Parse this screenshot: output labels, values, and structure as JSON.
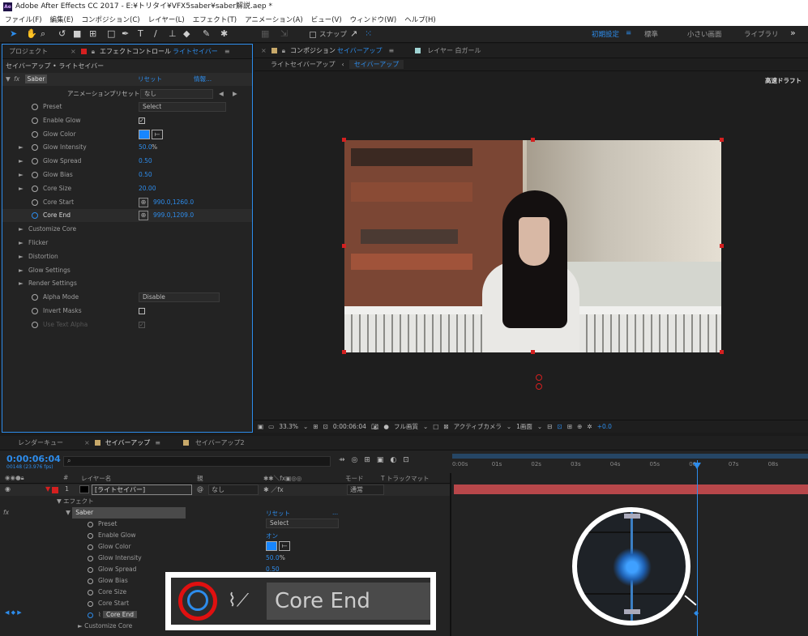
{
  "window": {
    "title": "Adobe After Effects CC 2017 - E:¥トリタイ¥VFX5saber¥saber解説.aep *"
  },
  "menu": [
    "ファイル(F)",
    "編集(E)",
    "コンポジション(C)",
    "レイヤー(L)",
    "エフェクト(T)",
    "アニメーション(A)",
    "ビュー(V)",
    "ウィンドウ(W)",
    "ヘルプ(H)"
  ],
  "toolbar": {
    "snap": "スナップ",
    "workspaces": [
      "初期設定",
      "標準",
      "小さい画面",
      "ライブラリ"
    ],
    "more": "»"
  },
  "left_panel": {
    "tab_project": "プロジェクト",
    "tab_effect_prefix": "エフェクトコントロール",
    "tab_effect_layer": "ライトセイバー",
    "breadcrumb": "セイバーアップ • ライトセイバー",
    "fx": "fx",
    "effect_name": "Saber",
    "reset": "リセット",
    "about": "情報...",
    "preset_label": "アニメーションプリセット：",
    "preset_value": "なし",
    "props": [
      {
        "name": "Preset",
        "kind": "dropdown",
        "value": "Select"
      },
      {
        "name": "Enable Glow",
        "kind": "check",
        "value": "✓"
      },
      {
        "name": "Glow Color",
        "kind": "color",
        "value": "#1786ff"
      },
      {
        "name": "Glow Intensity",
        "kind": "num",
        "value": "50.0",
        "suffix": "%",
        "twirl": "►"
      },
      {
        "name": "Glow Spread",
        "kind": "num",
        "value": "0.50",
        "twirl": "►"
      },
      {
        "name": "Glow Bias",
        "kind": "num",
        "value": "0.50",
        "twirl": "►"
      },
      {
        "name": "Core Size",
        "kind": "num",
        "value": "20.00",
        "twirl": "►"
      },
      {
        "name": "Core Start",
        "kind": "point",
        "value": "990.0,1260.0"
      },
      {
        "name": "Core End",
        "kind": "point",
        "value": "999.0,1209.0"
      }
    ],
    "groups": [
      "Customize Core",
      "Flicker",
      "Distortion",
      "Glow Settings",
      "Render Settings"
    ],
    "props2": [
      {
        "name": "Alpha Mode",
        "kind": "dropdown",
        "value": "Disable"
      },
      {
        "name": "Invert Masks",
        "kind": "check",
        "value": ""
      },
      {
        "name": "Use Text Alpha",
        "kind": "check",
        "value": "✓"
      }
    ]
  },
  "comp_panel": {
    "tab_prefix": "コンポジション",
    "tab_name": "セイバーアップ",
    "tab_layer": "レイヤー 白ガール",
    "sub1": "ライトセイバーアップ",
    "sub2": "セイバーアップ",
    "draft": "高速ドラフト",
    "zoom": "33.3%",
    "timecode": "0:00:06:04",
    "resolution": "フル画質",
    "camera": "アクティブカメラ",
    "views": "1画面",
    "exposure": "+0.0"
  },
  "timeline": {
    "tab_render": "レンダーキュー",
    "tab_comp": "セイバーアップ",
    "tab_comp2": "セイバーアップ2",
    "timecode": "0:00:06:04",
    "fps": "00148 (23.976 fps)",
    "search_icon": "search-icon",
    "col_layer": "レイヤー名",
    "col_parent": "親",
    "col_mode": "モード",
    "col_track": "T トラックマット",
    "layer_num": "1",
    "layer_name": "[ライトセイバー]",
    "parent_value": "なし",
    "mode_value": "通常",
    "effects": "エフェクト",
    "effect": "Saber",
    "reset": "リセット",
    "preset_value": "Select",
    "enable_glow_value": "オン",
    "intensity_value": "50.0",
    "intensity_suffix": "%",
    "spread_value": "0.50",
    "props": [
      "Preset",
      "Enable Glow",
      "Glow Color",
      "Glow Intensity",
      "Glow Spread",
      "Glow Bias",
      "Core Size",
      "Core Start",
      "Core End"
    ],
    "customize": "Customize Core",
    "ruler": [
      "0:00s",
      "01s",
      "02s",
      "03s",
      "04s",
      "05s",
      "06s",
      "07s",
      "08s"
    ]
  },
  "zoom_callout": {
    "label": "Core End"
  },
  "colors": {
    "accent": "#2d8ceb",
    "layer_bar": "#b8474a",
    "handle": "#d42020"
  }
}
